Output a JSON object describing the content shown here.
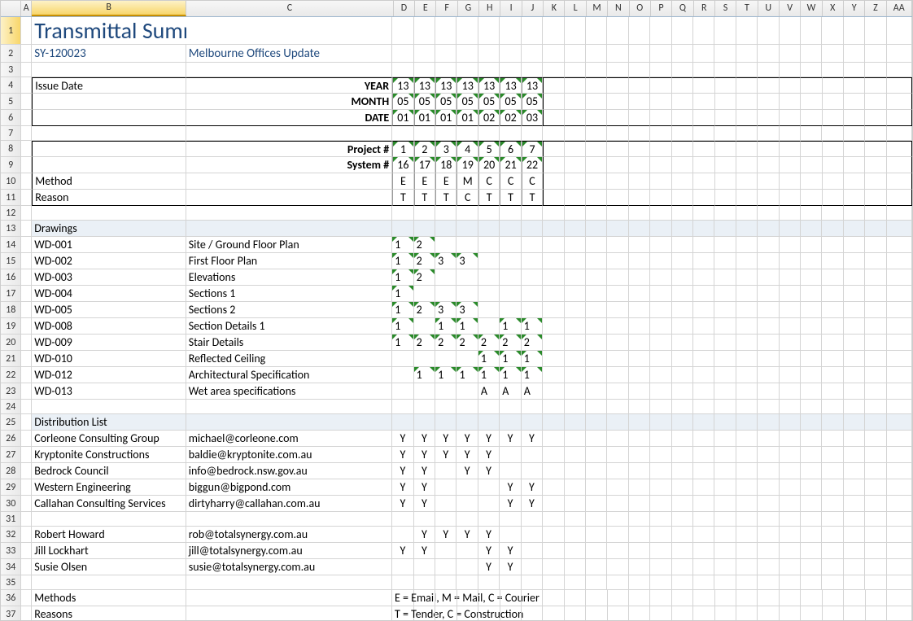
{
  "columns": [
    "A",
    "B",
    "C",
    "D",
    "E",
    "F",
    "G",
    "H",
    "I",
    "J",
    "K",
    "L",
    "M",
    "N",
    "O",
    "P",
    "Q",
    "R",
    "S",
    "T",
    "U",
    "V",
    "W",
    "X",
    "Y",
    "Z",
    "AA"
  ],
  "title": "Transmittal Summary",
  "project_code": "SY-120023",
  "project_name": "Melbourne Offices Update",
  "issue_date_label": "Issue Date",
  "year_label": "YEAR",
  "month_label": "MONTH",
  "date_label": "DATE",
  "project_num_label": "Project #",
  "system_num_label": "System #",
  "method_label": "Method",
  "reason_label": "Reason",
  "years": [
    "13",
    "13",
    "13",
    "13",
    "13",
    "13",
    "13"
  ],
  "months": [
    "05",
    "05",
    "05",
    "05",
    "05",
    "05",
    "05"
  ],
  "dates": [
    "01",
    "01",
    "01",
    "01",
    "02",
    "02",
    "03"
  ],
  "project_nums": [
    "1",
    "2",
    "3",
    "4",
    "5",
    "6",
    "7"
  ],
  "system_nums": [
    "16",
    "17",
    "18",
    "19",
    "20",
    "21",
    "22"
  ],
  "methods": [
    "E",
    "E",
    "E",
    "M",
    "C",
    "C",
    "C"
  ],
  "reasons": [
    "T",
    "T",
    "T",
    "C",
    "T",
    "T",
    "T"
  ],
  "drawings_hdr": "Drawings",
  "drawings": [
    {
      "code": "WD-001",
      "desc": "Site / Ground Floor Plan",
      "cells": [
        "1",
        "2",
        "",
        "",
        "",
        "",
        ""
      ]
    },
    {
      "code": "WD-002",
      "desc": "First Floor Plan",
      "cells": [
        "1",
        "2",
        "3",
        "3",
        "",
        "",
        ""
      ]
    },
    {
      "code": "WD-003",
      "desc": "Elevations",
      "cells": [
        "1",
        "2",
        "",
        "",
        "",
        "",
        ""
      ]
    },
    {
      "code": "WD-004",
      "desc": "Sections 1",
      "cells": [
        "1",
        "",
        "",
        "",
        "",
        "",
        ""
      ]
    },
    {
      "code": "WD-005",
      "desc": "Sections 2",
      "cells": [
        "1",
        "2",
        "3",
        "3",
        "",
        "",
        ""
      ]
    },
    {
      "code": "WD-008",
      "desc": "Section Details 1",
      "cells": [
        "1",
        "",
        "1",
        "1",
        "",
        "1",
        "1"
      ]
    },
    {
      "code": "WD-009",
      "desc": "Stair Details",
      "cells": [
        "1",
        "2",
        "2",
        "2",
        "2",
        "2",
        "2"
      ]
    },
    {
      "code": "WD-010",
      "desc": "Reflected Ceiling",
      "cells": [
        "",
        "",
        "",
        "",
        "1",
        "1",
        "1"
      ]
    },
    {
      "code": "WD-012",
      "desc": "Architectural Specification",
      "cells": [
        "",
        "1",
        "1",
        "1",
        "1",
        "1",
        "1"
      ]
    },
    {
      "code": "WD-013",
      "desc": "Wet area specifications",
      "cells": [
        "",
        "",
        "",
        "",
        "A",
        "A",
        "A"
      ]
    }
  ],
  "dist_hdr": "Distribution List",
  "dist": [
    {
      "name": "Corleone Consulting Group",
      "email": "michael@corleone.com",
      "cells": [
        "Y",
        "Y",
        "Y",
        "Y",
        "Y",
        "Y",
        "Y"
      ]
    },
    {
      "name": "Kryptonite Constructions",
      "email": "baldie@kryptonite.com.au",
      "cells": [
        "Y",
        "Y",
        "Y",
        "Y",
        "Y",
        "",
        ""
      ]
    },
    {
      "name": "Bedrock Council",
      "email": "info@bedrock.nsw.gov.au",
      "cells": [
        "Y",
        "Y",
        "",
        "Y",
        "Y",
        "",
        ""
      ]
    },
    {
      "name": "Western Engineering",
      "email": "biggun@bigpond.com",
      "cells": [
        "Y",
        "Y",
        "",
        "",
        "",
        "Y",
        "Y"
      ]
    },
    {
      "name": "Callahan Consulting Services",
      "email": "dirtyharry@callahan.com.au",
      "cells": [
        "Y",
        "Y",
        "",
        "",
        "",
        "Y",
        "Y"
      ]
    }
  ],
  "staff": [
    {
      "name": "Robert Howard",
      "email": "rob@totalsynergy.com.au",
      "cells": [
        "",
        "Y",
        "Y",
        "Y",
        "Y",
        "",
        ""
      ]
    },
    {
      "name": "Jill Lockhart",
      "email": "jill@totalsynergy.com.au",
      "cells": [
        "Y",
        "Y",
        "",
        "",
        "Y",
        "Y",
        ""
      ]
    },
    {
      "name": "Susie Olsen",
      "email": "susie@totalsynergy.com.au",
      "cells": [
        "",
        "",
        "",
        "",
        "Y",
        "Y",
        ""
      ]
    }
  ],
  "methods_legend_label": "Methods",
  "reasons_legend_label": "Reasons",
  "methods_legend": "E = Email, M = Mail, C = Courier",
  "reasons_legend": "T = Tender, C = Construction"
}
